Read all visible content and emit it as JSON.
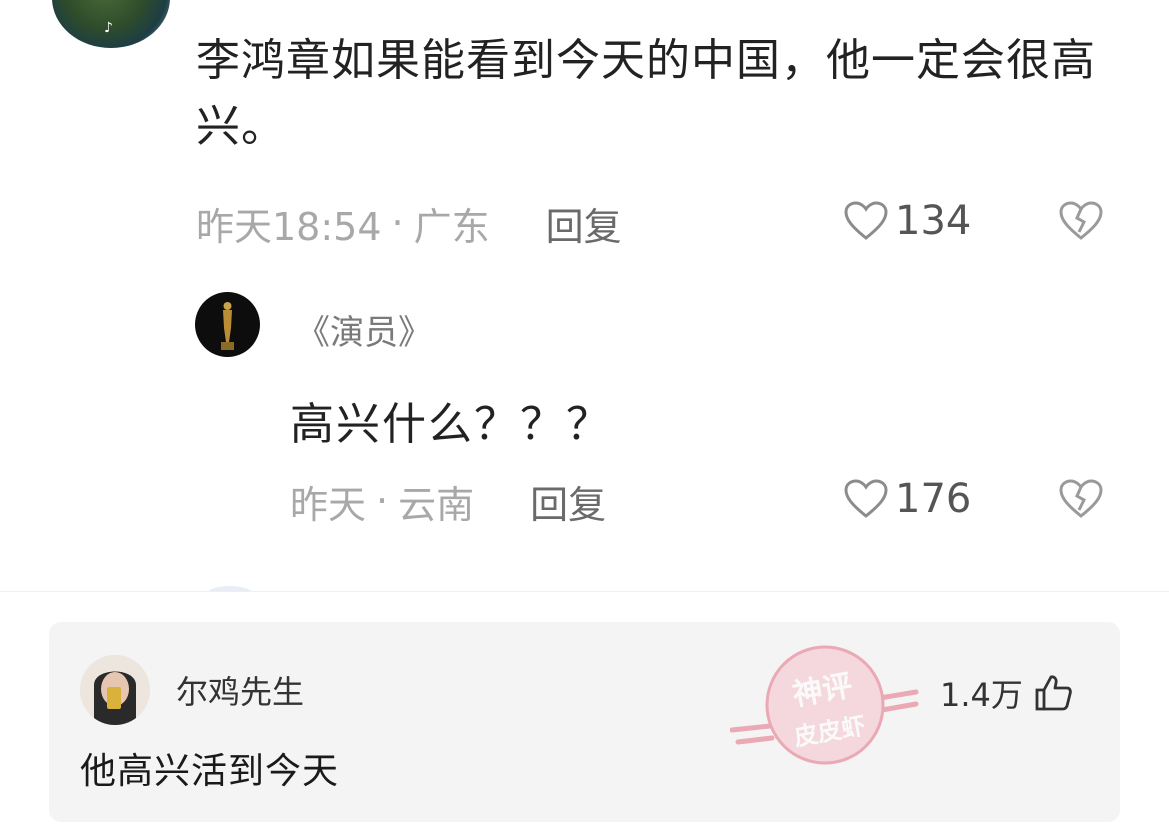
{
  "top_comment": {
    "text": "李鸿章如果能看到今天的中国，他一定会很高兴。",
    "time": "昨天18:54",
    "location": "广东",
    "separator": "·",
    "reply_label": "回复",
    "likes": "134",
    "avatar_mark": "♪"
  },
  "reply_comment": {
    "username": "《演员》",
    "text": "高兴什么？？？",
    "time": "昨天",
    "location": "云南",
    "separator": "·",
    "reply_label": "回复",
    "likes": "176"
  },
  "featured_comment": {
    "username": "尔鸡先生",
    "text": "他高兴活到今天",
    "likes": "1.4万"
  },
  "watermark": {
    "line1": "神评",
    "line2": "皮皮虾"
  },
  "icons": {
    "like": "heart-outline-icon",
    "dislike": "broken-heart-icon",
    "thumbs_up": "thumbs-up-icon"
  },
  "colors": {
    "meta_gray": "#a8a8a8",
    "watermark_red": "#e5788a",
    "card_bg": "#f4f4f4"
  }
}
